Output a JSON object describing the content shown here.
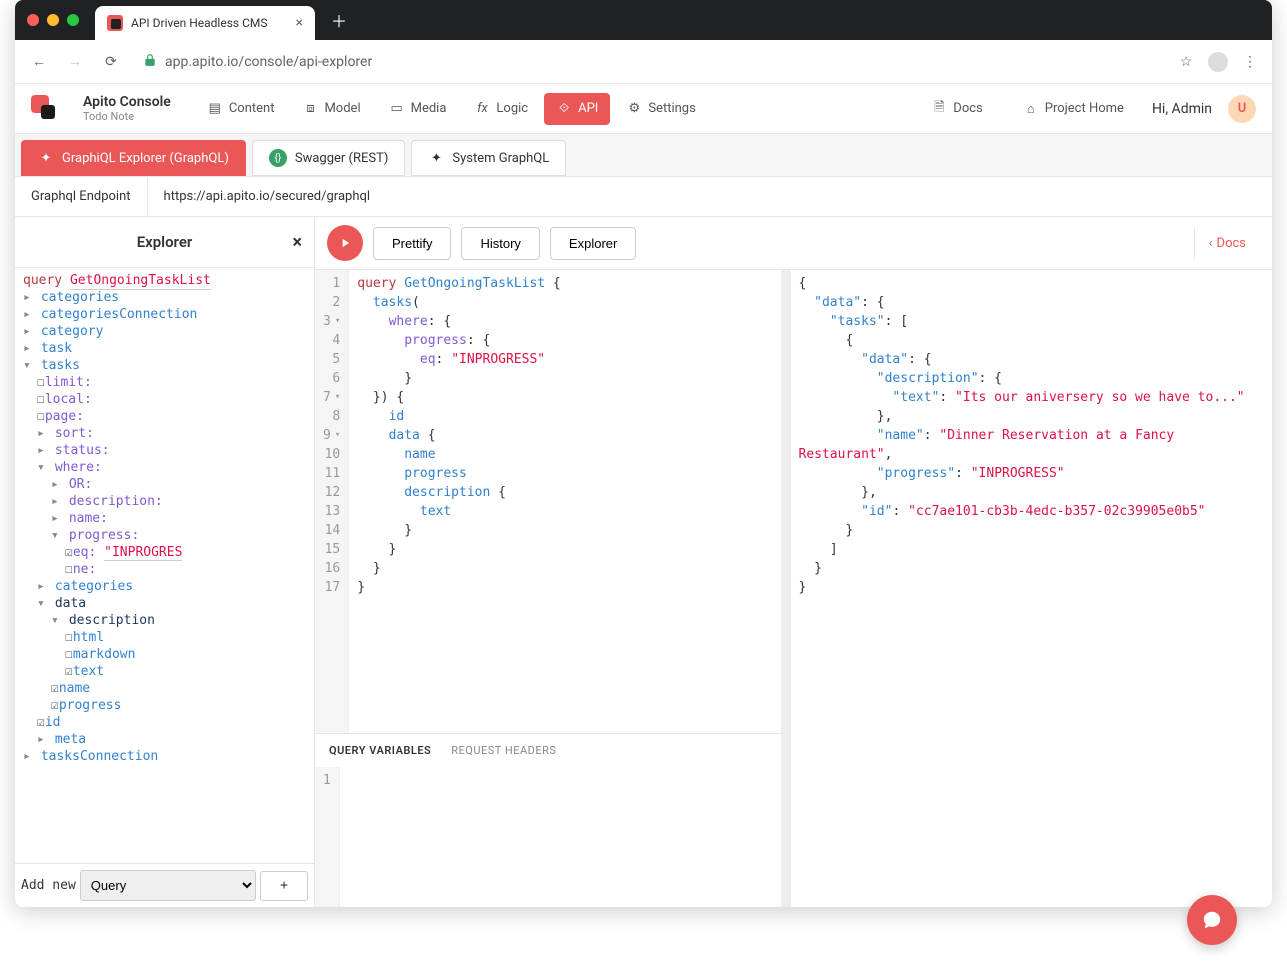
{
  "browser": {
    "tab_title": "API Driven Headless CMS",
    "url_display": "app.apito.io/console/api-explorer"
  },
  "header": {
    "app_name": "Apito Console",
    "project": "Todo Note",
    "nav": {
      "content": "Content",
      "model": "Model",
      "media": "Media",
      "logic": "Logic",
      "api": "API",
      "settings": "Settings"
    },
    "docs": "Docs",
    "project_home": "Project Home",
    "greeting": "Hi, Admin",
    "avatar_initial": "U"
  },
  "sub_tabs": {
    "graphiql": "GraphiQL Explorer (GraphQL)",
    "swagger": "Swagger (REST)",
    "system": "System GraphQL"
  },
  "endpoint": {
    "label": "Graphql Endpoint",
    "value": "https://api.apito.io/secured/graphql"
  },
  "explorer": {
    "title": "Explorer",
    "query_kw": "query",
    "op_name": "GetOngoingTaskList",
    "top_fields": [
      "categories",
      "categoriesConnection",
      "category",
      "task"
    ],
    "tasks_label": "tasks",
    "attrs": {
      "limit": "limit:",
      "local": "local:",
      "page": "page:",
      "sort": "sort:",
      "status": "status:",
      "where": "where:",
      "or": "OR:",
      "description": "description:",
      "name": "name:",
      "progress": "progress:",
      "eq": "eq:",
      "eq_val": "\"INPROGRES",
      "ne": "ne:"
    },
    "fields2": {
      "categories": "categories",
      "data": "data",
      "description": "description",
      "html": "html",
      "markdown": "markdown",
      "text": "text",
      "name": "name",
      "progress": "progress",
      "id": "id",
      "meta": "meta",
      "tasks_connection": "tasksConnection"
    },
    "footer": {
      "add_new": "Add new",
      "option": "Query"
    }
  },
  "toolbar": {
    "prettify": "Prettify",
    "history": "History",
    "explorer": "Explorer",
    "docs": "Docs"
  },
  "query_code": {
    "lines": [
      "query GetOngoingTaskList {",
      "  tasks(",
      "    where: {",
      "      progress: {",
      "        eq: \"INPROGRESS\"",
      "      }",
      "  }) {",
      "    id",
      "    data {",
      "      name",
      "      progress",
      "      description {",
      "        text",
      "      }",
      "    }",
      "  }",
      "}"
    ]
  },
  "vars": {
    "query_variables": "QUERY VARIABLES",
    "request_headers": "REQUEST HEADERS"
  },
  "result": {
    "data_key": "\"data\"",
    "tasks_key": "\"tasks\"",
    "desc_key": "\"description\"",
    "text_key": "\"text\"",
    "text_val": "\"Its our aniversery so we have to...\"",
    "name_key": "\"name\"",
    "name_val": "\"Dinner Reservation at a Fancy Restaurant\"",
    "progress_key": "\"progress\"",
    "progress_val": "\"INPROGRESS\"",
    "id_key": "\"id\"",
    "id_val": "\"cc7ae101-cb3b-4edc-b357-02c39905e0b5\""
  }
}
